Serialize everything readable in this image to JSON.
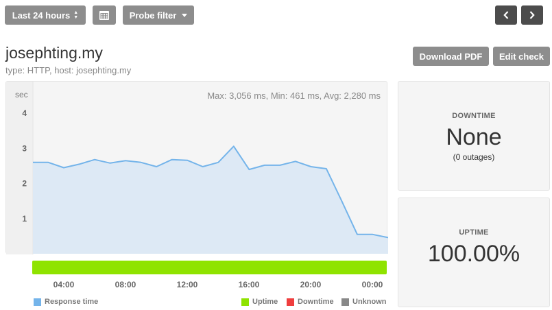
{
  "toolbar": {
    "range_label": "Last 24 hours",
    "probe_filter_label": "Probe filter"
  },
  "check": {
    "title": "josephting.my",
    "subtitle": "type: HTTP, host: josephting.my"
  },
  "actions": {
    "download_pdf": "Download PDF",
    "edit_check": "Edit check"
  },
  "chart_data": {
    "type": "area",
    "ylabel": "sec",
    "summary": "Max: 3,056 ms, Min: 461 ms, Avg: 2,280 ms",
    "y_ticks": [
      "1",
      "2",
      "3",
      "4"
    ],
    "ylim": [
      0,
      4.9
    ],
    "x_ticks": [
      "04:00",
      "08:00",
      "12:00",
      "16:00",
      "20:00",
      "00:00"
    ],
    "series": [
      {
        "name": "Response time",
        "values": [
          2.6,
          2.6,
          2.45,
          2.55,
          2.68,
          2.58,
          2.65,
          2.6,
          2.48,
          2.68,
          2.66,
          2.48,
          2.6,
          3.06,
          2.4,
          2.52,
          2.52,
          2.63,
          2.48,
          2.42,
          1.5,
          0.55,
          0.55,
          0.46
        ]
      }
    ],
    "colors": {
      "line": "#74b4ea",
      "fill": "#dde9f5",
      "uptime": "#8fe300",
      "downtime": "#ef3e3e",
      "unknown": "#888888"
    }
  },
  "legend": {
    "response_time": "Response time",
    "uptime": "Uptime",
    "downtime": "Downtime",
    "unknown": "Unknown"
  },
  "downtime": {
    "label": "DOWNTIME",
    "value": "None",
    "sub": "(0 outages)"
  },
  "uptime": {
    "label": "UPTIME",
    "value": "100.00%"
  }
}
